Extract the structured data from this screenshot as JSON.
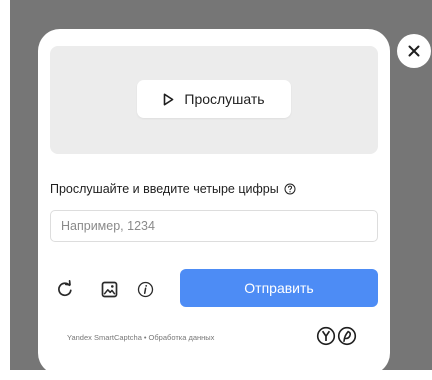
{
  "audio": {
    "play_label": "Прослушать"
  },
  "instruction": {
    "text": "Прослушайте и введите четыре цифры"
  },
  "input": {
    "value": "",
    "placeholder": "Например, 1234"
  },
  "actions": {
    "submit_label": "Отправить"
  },
  "footer": {
    "brand": "Yandex SmartCaptcha",
    "separator": "•",
    "data_link": "Обработка данных"
  },
  "icons": {
    "close": "close-icon",
    "play": "play-icon",
    "help": "help-icon",
    "refresh": "refresh-icon",
    "image": "image-icon",
    "info": "info-icon"
  },
  "colors": {
    "accent": "#4d8cf5",
    "overlay": "#767676",
    "panel": "#ececec"
  }
}
